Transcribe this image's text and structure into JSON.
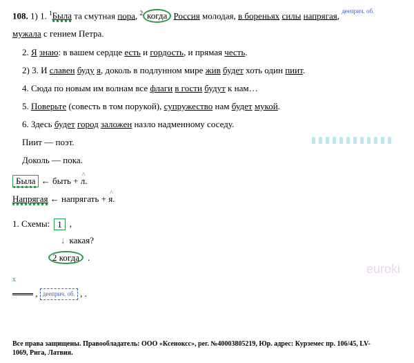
{
  "exercise": {
    "number": "108.",
    "group1_label": "1)",
    "item1_num": "1.",
    "sup1": "1",
    "w1": "Была",
    "t1a": "та смутная",
    "w1b": "пора",
    "t1c": ",",
    "sup2": "2",
    "w1d": "когда",
    "w1e": "Россия",
    "t1f": "молодая,",
    "w1g": "в бореньях",
    "w1h": "силы",
    "w1i": "напрягая",
    "t1j": ",",
    "ann1": "дееприч. об.",
    "w1k": "мужала",
    "t1l": "с гением Петра.",
    "item2_num": "2.",
    "w2a": "Я",
    "w2b": "знаю",
    "t2c": ": в вашем сердце",
    "w2d": "есть",
    "t2e": "и",
    "w2f": "гордость",
    "t2g": ", и прямая",
    "w2h": "честь",
    "t2i": ".",
    "group2_label": "2)",
    "item3_num": "3.",
    "t3a": "И",
    "w3b": "славен",
    "w3c": "буду",
    "w3d": "я",
    "t3e": ", доколь в подлунном мире",
    "w3f": "жив",
    "w3g": "будет",
    "t3h": "хоть один",
    "w3i": "пиит",
    "t3j": ".",
    "item4_num": "4.",
    "t4a": "Сюда по новым им волнам все",
    "w4b": "флаги",
    "w4c": "в гости",
    "w4d": "будут",
    "t4e": "к нам…",
    "item5_num": "5.",
    "w5a": "Поверьте",
    "t5b": "(совесть в том порукой),",
    "w5c": "супружество",
    "t5d": "нам",
    "w5e": "будет",
    "w5f": "мукой",
    "t5g": ".",
    "item6_num": "6.",
    "t6a": "Здесь",
    "w6b": "будет",
    "w6c": "город",
    "w6d": "заложен",
    "t6e": "назло надменному соседу.",
    "gloss1_left": "Пиит",
    "gloss1_sep": " — ",
    "gloss1_right": "поэт.",
    "gloss2_left": "Доколь",
    "gloss2_sep": " — ",
    "gloss2_right": "пока."
  },
  "morph": {
    "line1_word": "Была",
    "line1_arrow": "←",
    "line1_part1": "быть +",
    "line1_suffix": "л",
    "line1_end": ".",
    "line2_word": "Напрягая",
    "line2_arrow": "←",
    "line2_part1": "напрягать +",
    "line2_suffix": "я",
    "line2_end": "."
  },
  "schema": {
    "label": "1. Схемы:",
    "box1": "1",
    "comma": ",",
    "q_label": "какая?",
    "box2_num": "2",
    "box2_word": "когда",
    "dot": ".",
    "bottom_label": "дееприч. об."
  },
  "footer": {
    "line1": "Все права защищены. Правообладатель: ООО «Ксеноксс», рег. №40003805219, Юр. адрес: Курземес пр. 106/45, LV-",
    "line2": "1069, Рига, Латвия."
  },
  "watermark": "euroki"
}
